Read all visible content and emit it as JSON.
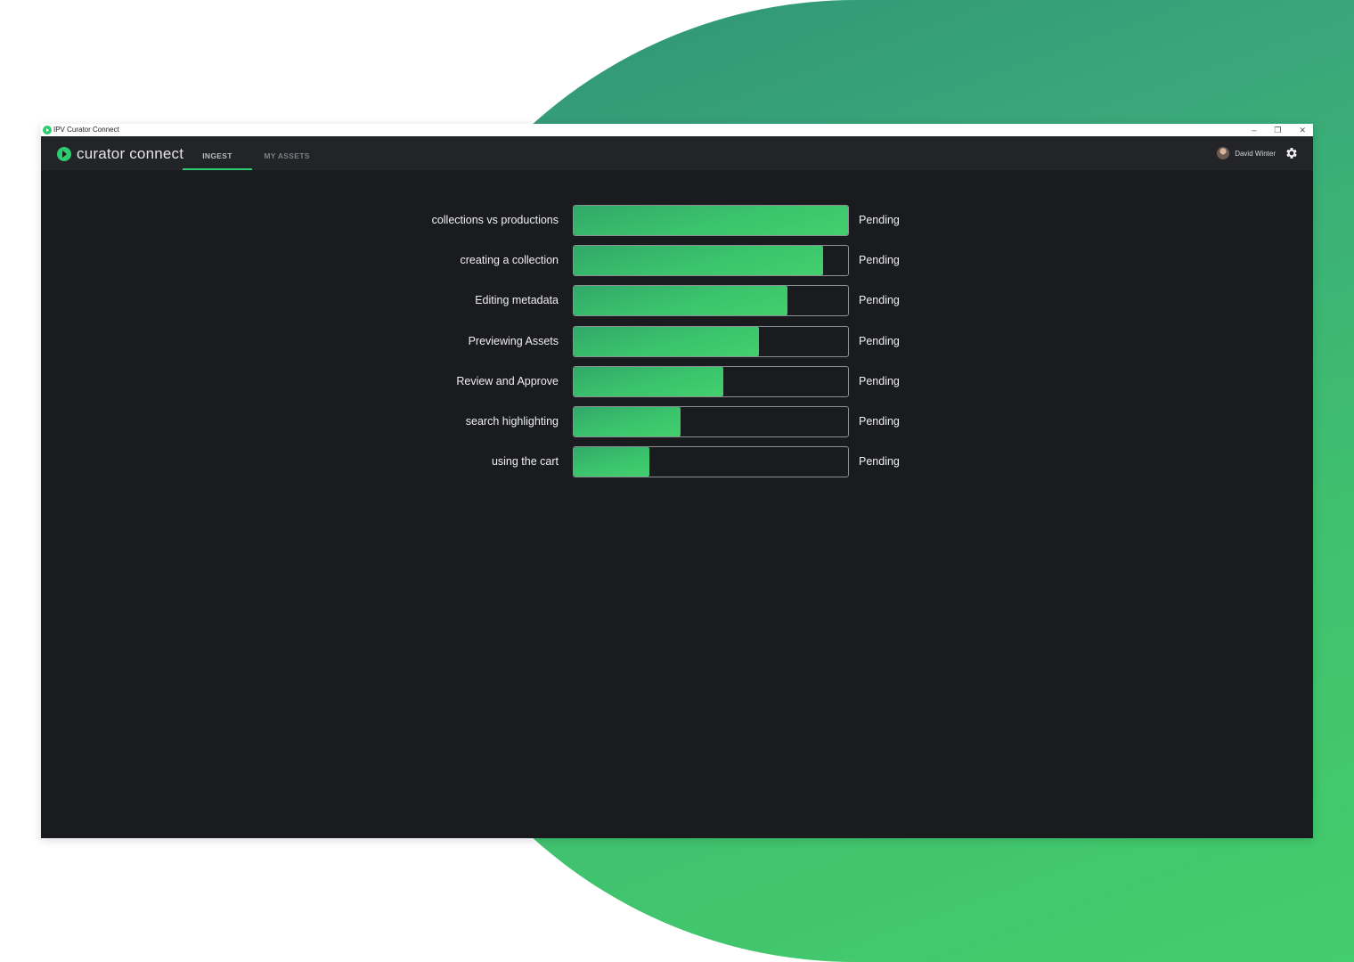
{
  "window": {
    "title": "IPV Curator Connect",
    "controls": [
      "–",
      "❐",
      "✕"
    ]
  },
  "appbar": {
    "logo_text": "curator connect",
    "tabs": [
      {
        "label": "INGEST",
        "active": true
      },
      {
        "label": "MY ASSETS",
        "active": false
      }
    ],
    "user_name": "David Winter"
  },
  "ingest_items": [
    {
      "name": "collections vs productions",
      "progress": 1.0,
      "status": "Pending"
    },
    {
      "name": "creating a collection",
      "progress": 0.91,
      "status": "Pending"
    },
    {
      "name": "Editing metadata",
      "progress": 0.78,
      "status": "Pending"
    },
    {
      "name": "Previewing Assets",
      "progress": 0.675,
      "status": "Pending"
    },
    {
      "name": "Review and Approve",
      "progress": 0.545,
      "status": "Pending"
    },
    {
      "name": "search highlighting",
      "progress": 0.39,
      "status": "Pending"
    },
    {
      "name": "using the cart",
      "progress": 0.275,
      "status": "Pending"
    }
  ],
  "colors": {
    "accent": "#2ecc71",
    "window_bg": "#1a1b1f",
    "appbar_bg": "#232428",
    "background_gradient_start": "#2f9277",
    "background_gradient_end": "#44cd6c"
  }
}
